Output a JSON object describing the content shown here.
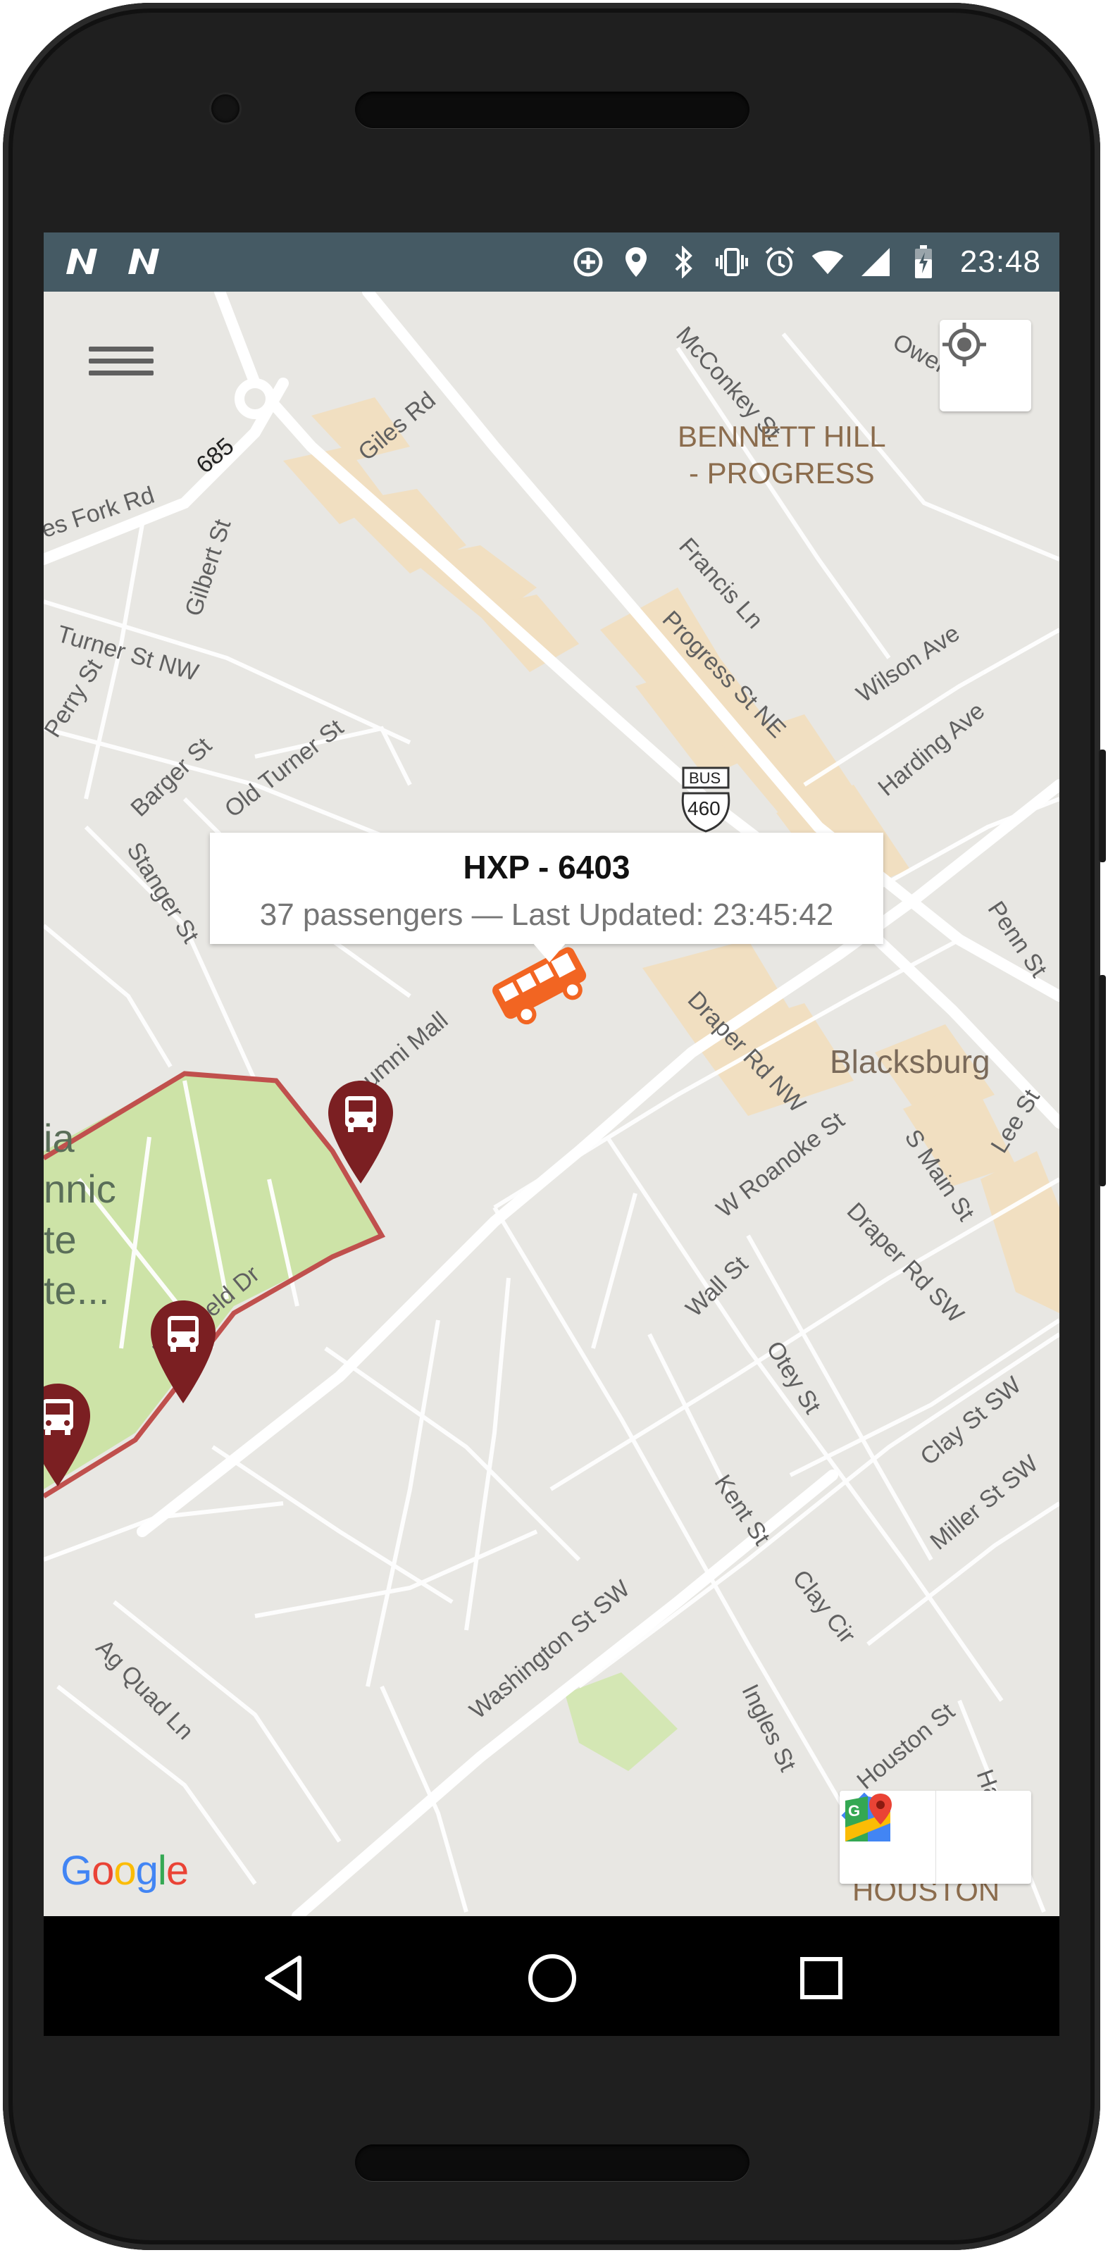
{
  "statusbar": {
    "time": "23:48",
    "left_icons": [
      "n-notification-icon",
      "n-notification-icon"
    ],
    "right_icons": [
      "data-saver-icon",
      "location-icon",
      "bluetooth-icon",
      "vibrate-icon",
      "alarm-icon",
      "wifi-icon",
      "signal-icon",
      "battery-charging-icon"
    ]
  },
  "map": {
    "area_labels": {
      "bennett_hill": "BENNETT HILL\n- PROGRESS",
      "blacksburg": "Blacksburg",
      "houston": "HOUSTON",
      "campus": "ia\nnnic\nte\nte..."
    },
    "streets": {
      "mcconkey": "McConkey St",
      "owens": "Owens St",
      "giles": "Giles Rd",
      "route685": "685",
      "fork": "es Fork Rd",
      "gilbert": "Gilbert St",
      "francis": "Francis Ln",
      "progress": "Progress St NE",
      "turner": "Turner St NW",
      "wilson": "Wilson Ave",
      "perry": "Perry St",
      "barger": "Barger St",
      "old_turner": "Old Turner St",
      "harding": "Harding Ave",
      "stanger": "Stanger St",
      "penn": "Penn St",
      "alumni": "umni Mall",
      "draper_nw": "Draper Rd NW",
      "main": "S Main St",
      "lee": "Lee St",
      "w_roanoke": "W Roanoke St",
      "draper_sw": "Draper Rd SW",
      "duckfield": "Duckfield Dr",
      "wall": "Wall St",
      "otey": "Otey St",
      "clay": "Clay St SW",
      "kent": "Kent St",
      "miller": "Miller St SW",
      "clay_cir": "Clay Cir",
      "ag_quad": "Ag Quad Ln",
      "washington": "Washington St SW",
      "ingles": "Ingles St",
      "houston_st": "Houston St",
      "hard": "Har..."
    },
    "shield": {
      "top": "BUS",
      "number": "460"
    }
  },
  "popup": {
    "title": "HXP - 6403",
    "subtitle": "37 passengers — Last Updated: 23:45:42"
  },
  "google_logo": {
    "letters": [
      "G",
      "o",
      "o",
      "g",
      "l",
      "e"
    ],
    "colors": [
      "#4285F4",
      "#EA4335",
      "#FBBC05",
      "#4285F4",
      "#34A853",
      "#EA4335"
    ]
  },
  "colors": {
    "statusbar": "#455a64",
    "bus_vehicle": "#f26522",
    "stop_marker": "#7b1f22",
    "route_line": "#c0504d",
    "campus_fill": "#cde3a7"
  }
}
